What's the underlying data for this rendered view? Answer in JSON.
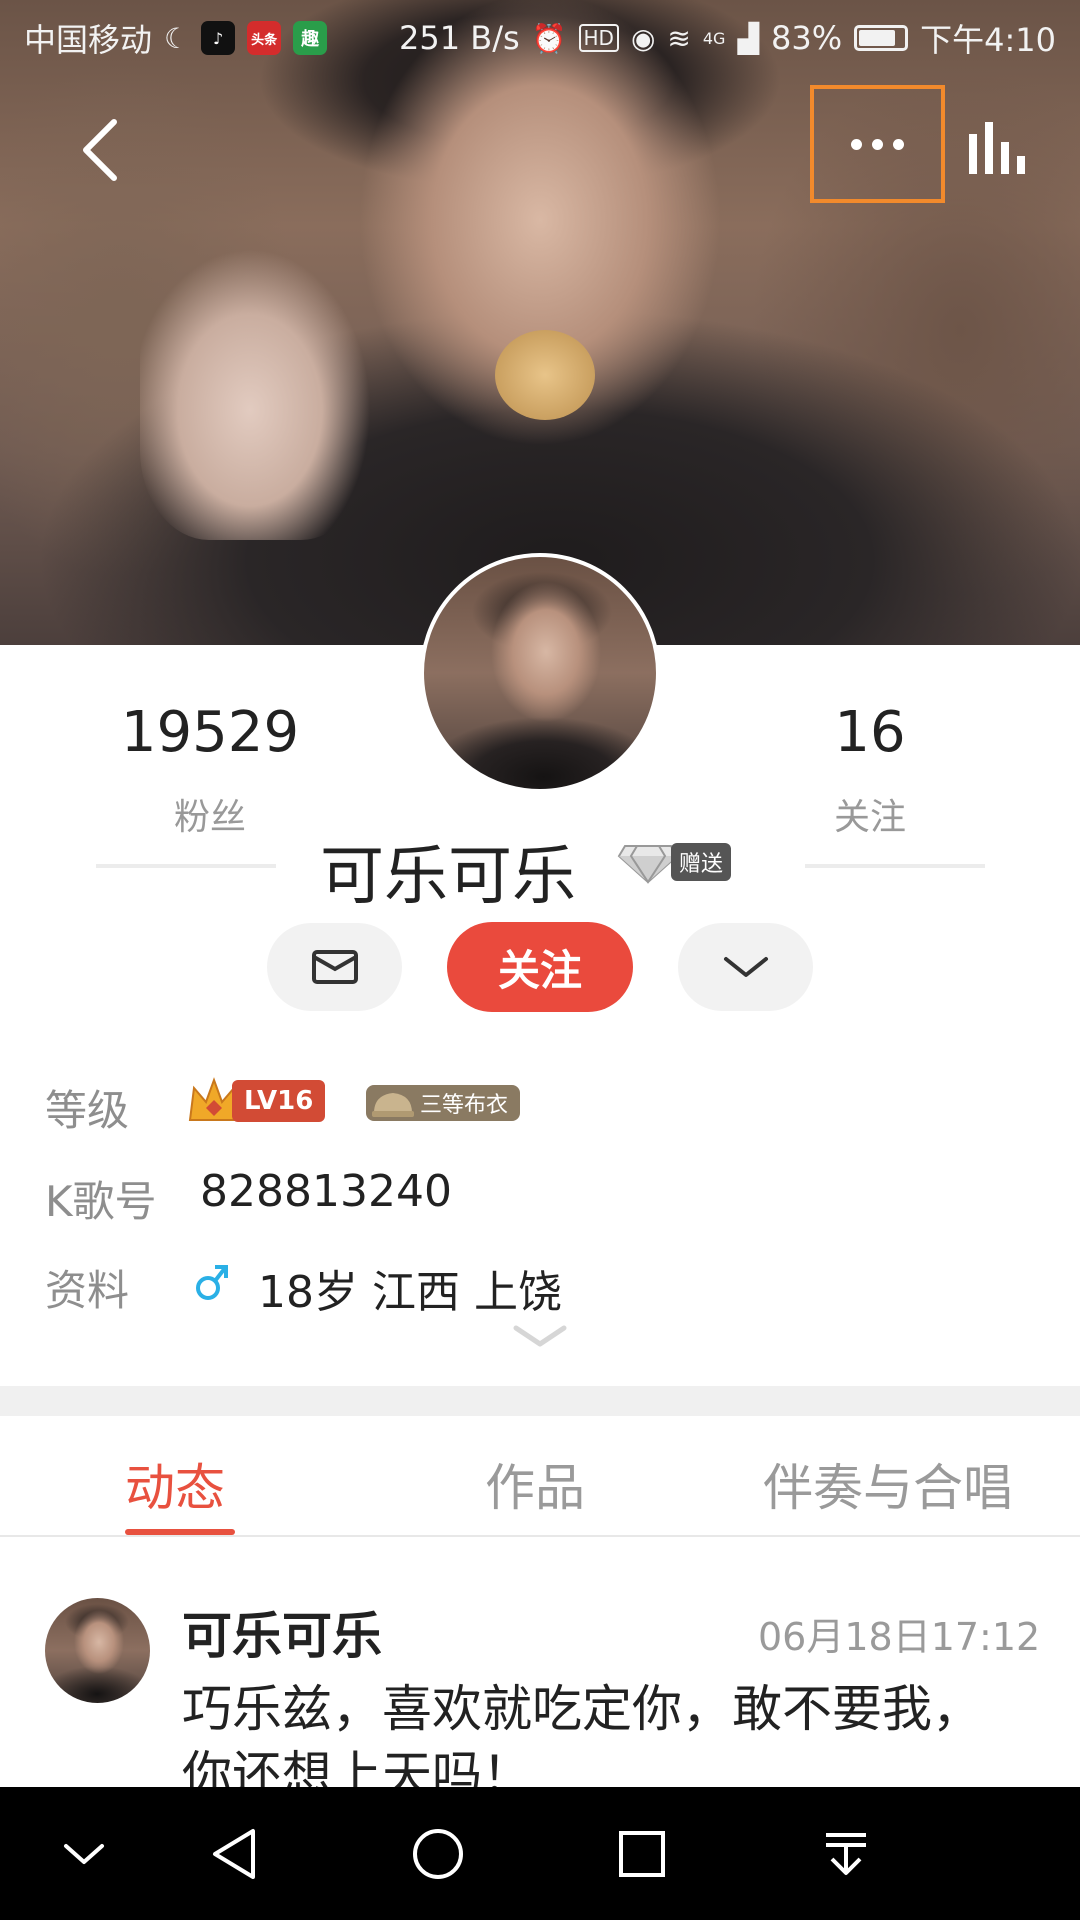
{
  "status_bar": {
    "carrier": "中国移动",
    "app_badges": [
      {
        "name": "douyin",
        "text": "♪",
        "color": "#111111"
      },
      {
        "name": "toutiao",
        "text": "头条",
        "color": "#d42c2c"
      },
      {
        "name": "qu",
        "text": "趣",
        "color": "#2a9d4a"
      }
    ],
    "speed": "251 B/s",
    "hd": "HD",
    "net": "4G",
    "battery": "83%",
    "time": "下午4:10"
  },
  "profile": {
    "fans_count": "19529",
    "fans_label": "粉丝",
    "following_count": "16",
    "following_label": "关注",
    "username": "可乐可乐",
    "gift_label": "赠送",
    "follow_button": "关注"
  },
  "info": {
    "level_label": "等级",
    "level_badge": "LV16",
    "rank_badge": "三等布衣",
    "kid_label": "K歌号",
    "kid_value": "828813240",
    "profile_label": "资料",
    "profile_value": "18岁  江西 上饶"
  },
  "tabs": [
    {
      "label": "动态",
      "active": true
    },
    {
      "label": "作品",
      "active": false
    },
    {
      "label": "伴奏与合唱",
      "active": false
    }
  ],
  "feed": {
    "name": "可乐可乐",
    "time": "06月18日17:12",
    "text": "巧乐兹，喜欢就吃定你，敢不要我，你还想上天吗！"
  },
  "colors": {
    "accent": "#e8513f",
    "follow_button": "#ea4a3d",
    "highlight_box": "#f28a2c"
  }
}
